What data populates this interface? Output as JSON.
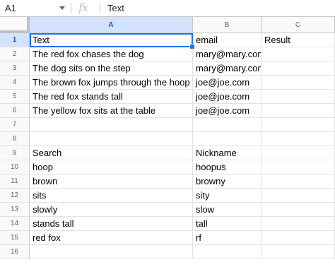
{
  "formula_bar": {
    "cell_ref": "A1",
    "fx_icon": "fx-icon",
    "content": "Text"
  },
  "columns": [
    "A",
    "B",
    "C"
  ],
  "rows": [
    {
      "num": "1",
      "a": "Text",
      "b": "email",
      "c": "Result"
    },
    {
      "num": "2",
      "a": "The red fox chases the dog",
      "b": "mary@mary.com",
      "c": ""
    },
    {
      "num": "3",
      "a": "The dog sits on the step",
      "b": "mary@mary.com",
      "c": ""
    },
    {
      "num": "4",
      "a": "The brown fox jumps through the hoop",
      "b": "joe@joe.com",
      "c": ""
    },
    {
      "num": "5",
      "a": "The red fox stands tall",
      "b": "joe@joe.com",
      "c": ""
    },
    {
      "num": "6",
      "a": "The yellow fox sits at the table",
      "b": "joe@joe.com",
      "c": ""
    },
    {
      "num": "7",
      "a": "",
      "b": "",
      "c": ""
    },
    {
      "num": "8",
      "a": "",
      "b": "",
      "c": ""
    },
    {
      "num": "9",
      "a": "Search",
      "b": "Nickname",
      "c": ""
    },
    {
      "num": "10",
      "a": "hoop",
      "b": "hoopus",
      "c": ""
    },
    {
      "num": "11",
      "a": "brown",
      "b": "browny",
      "c": ""
    },
    {
      "num": "12",
      "a": "sits",
      "b": "sity",
      "c": ""
    },
    {
      "num": "13",
      "a": "slowly",
      "b": "slow",
      "c": ""
    },
    {
      "num": "14",
      "a": "stands tall",
      "b": "tall",
      "c": ""
    },
    {
      "num": "15",
      "a": "red fox",
      "b": "rf",
      "c": ""
    },
    {
      "num": "16",
      "a": "",
      "b": "",
      "c": ""
    }
  ],
  "selection": {
    "cell": "A1",
    "color": "#1a73e8"
  },
  "colors": {
    "header_bg": "#f8f9fa",
    "selected_header_bg": "#d3e3fd",
    "gridline": "#e2e2e2"
  }
}
